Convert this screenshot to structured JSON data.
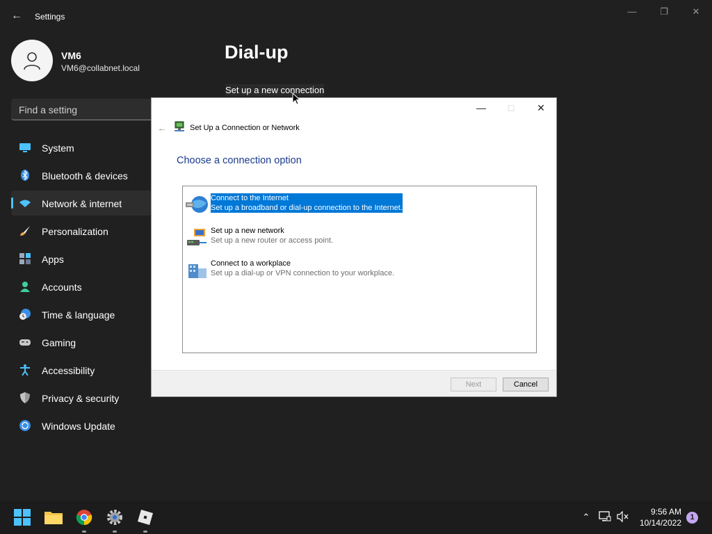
{
  "app": {
    "title": "Settings",
    "back_icon": "back-arrow-icon",
    "window_controls": [
      "minimize-icon",
      "maximize-icon",
      "close-icon"
    ]
  },
  "profile": {
    "name": "VM6",
    "email": "VM6@collabnet.local",
    "avatar_icon": "person-icon"
  },
  "search": {
    "placeholder": "Find a setting"
  },
  "sidebar": {
    "active_index": 2,
    "accent": "#4cc2ff",
    "items": [
      {
        "label": "System",
        "icon": "monitor-icon"
      },
      {
        "label": "Bluetooth & devices",
        "icon": "bluetooth-icon"
      },
      {
        "label": "Network & internet",
        "icon": "wifi-icon"
      },
      {
        "label": "Personalization",
        "icon": "brush-icon"
      },
      {
        "label": "Apps",
        "icon": "apps-icon"
      },
      {
        "label": "Accounts",
        "icon": "person-icon"
      },
      {
        "label": "Time & language",
        "icon": "clock-globe-icon"
      },
      {
        "label": "Gaming",
        "icon": "gamepad-icon"
      },
      {
        "label": "Accessibility",
        "icon": "accessibility-icon"
      },
      {
        "label": "Privacy & security",
        "icon": "shield-icon"
      },
      {
        "label": "Windows Update",
        "icon": "update-icon"
      }
    ]
  },
  "main": {
    "title": "Dial-up",
    "setup_link": "Set up a new connection"
  },
  "dialog": {
    "window_title": "Set Up a Connection or Network",
    "heading": "Choose a connection option",
    "selected_index": 0,
    "options": [
      {
        "title": "Connect to the Internet",
        "description": "Set up a broadband or dial-up connection to the Internet.",
        "icon": "globe-network-icon"
      },
      {
        "title": "Set up a new network",
        "description": "Set up a new router or access point.",
        "icon": "router-icon"
      },
      {
        "title": "Connect to a workplace",
        "description": "Set up a dial-up or VPN connection to your workplace.",
        "icon": "workplace-icon"
      }
    ],
    "next_label": "Next",
    "cancel_label": "Cancel"
  },
  "taskbar": {
    "apps": [
      "windows-start-icon",
      "file-explorer-icon",
      "chrome-icon",
      "settings-gear-icon",
      "roblox-icon"
    ],
    "tray": [
      "chevron-up-icon",
      "network-icon",
      "volume-muted-icon"
    ],
    "time": "9:56 AM",
    "date": "10/14/2022",
    "notification_count": "1"
  }
}
